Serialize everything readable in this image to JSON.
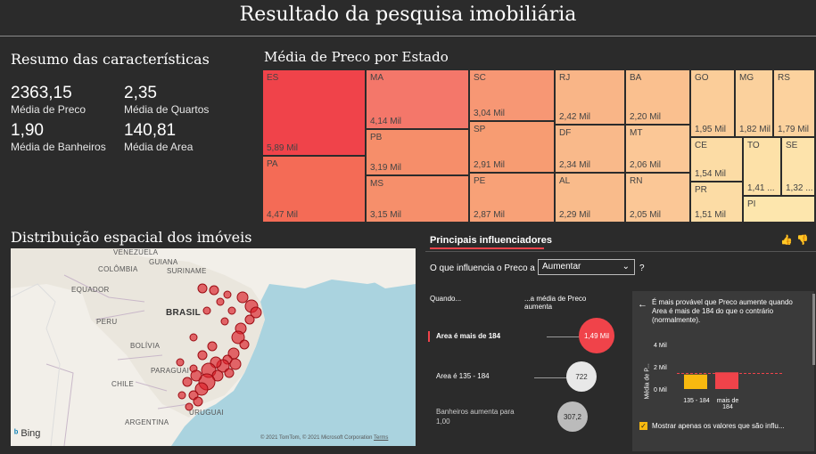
{
  "header": {
    "title": "Resultado da pesquisa imobiliária"
  },
  "summary": {
    "title": "Resumo das características",
    "kpis": [
      {
        "value": "2363,15",
        "label": "Média de Preco"
      },
      {
        "value": "2,35",
        "label": "Média de Quartos"
      },
      {
        "value": "1,90",
        "label": "Média de Banheiros"
      },
      {
        "value": "140,81",
        "label": "Média de Area"
      }
    ]
  },
  "treemap": {
    "title": "Média de Preco por Estado",
    "cells": [
      {
        "state": "ES",
        "value": "5,89 Mil",
        "color": "#f0434a"
      },
      {
        "state": "PA",
        "value": "4,47 Mil",
        "color": "#f46b56"
      },
      {
        "state": "MA",
        "value": "4,14 Mil",
        "color": "#f4776a"
      },
      {
        "state": "PB",
        "value": "3,19 Mil",
        "color": "#f68e6a"
      },
      {
        "state": "MS",
        "value": "3,15 Mil",
        "color": "#f68f6b"
      },
      {
        "state": "SC",
        "value": "3,04 Mil",
        "color": "#f79774"
      },
      {
        "state": "SP",
        "value": "2,91 Mil",
        "color": "#f79c72"
      },
      {
        "state": "PE",
        "value": "2,87 Mil",
        "color": "#f8a177"
      },
      {
        "state": "RJ",
        "value": "2,42 Mil",
        "color": "#f9b587"
      },
      {
        "state": "DF",
        "value": "2,34 Mil",
        "color": "#f9b98a"
      },
      {
        "state": "AL",
        "value": "2,29 Mil",
        "color": "#f9bb8b"
      },
      {
        "state": "BA",
        "value": "2,20 Mil",
        "color": "#fac08f"
      },
      {
        "state": "MT",
        "value": "2,06 Mil",
        "color": "#fbc796"
      },
      {
        "state": "RN",
        "value": "2,05 Mil",
        "color": "#fbc796"
      },
      {
        "state": "GO",
        "value": "1,95 Mil",
        "color": "#fbcd99"
      },
      {
        "state": "MG",
        "value": "1,82 Mil",
        "color": "#fbd19d"
      },
      {
        "state": "RS",
        "value": "1,79 Mil",
        "color": "#fcd29e"
      },
      {
        "state": "CE",
        "value": "1,54 Mil",
        "color": "#fcdca5"
      },
      {
        "state": "TO",
        "value": "1,41 ...",
        "color": "#fde1a8"
      },
      {
        "state": "SE",
        "value": "1,32 ...",
        "color": "#fde3ab"
      },
      {
        "state": "PR",
        "value": "1,51 Mil",
        "color": "#fcdca5"
      },
      {
        "state": "PI",
        "value": "",
        "color": "#fde6ad"
      }
    ]
  },
  "map": {
    "title": "Distribuição espacial dos imóveis",
    "labels": [
      "VENEZUELA",
      "GUIANA",
      "COLÔMBIA",
      "SURINAME",
      "EQUADOR",
      "PERU",
      "BRASIL",
      "BOLÍVIA",
      "PARAGUAI",
      "CHILE",
      "ARGENTINA",
      "URUGUAI"
    ],
    "bing": "Bing",
    "attribution": "© 2021 TomTom, © 2021 Microsoft Corporation",
    "terms": "Terms"
  },
  "influencers": {
    "tab": "Principais influenciadores",
    "question_prefix": "O que influencia o Preco a",
    "dropdown": "Aumentar",
    "question_suffix": "?",
    "col_when": "Quando...",
    "col_avg": "...a média de Preco aumenta",
    "rows": [
      {
        "label": "Area é mais de 184",
        "value": "1,49 Mil"
      },
      {
        "label": "Area é 135 - 184",
        "value": "722"
      },
      {
        "label": "Banheiros aumenta para",
        "sub": "1,00",
        "value": "307,2"
      }
    ],
    "detail": {
      "back": "←",
      "text": "É mais provável que Preco aumente quando Area é mais de 184 do que o contrário (normalmente).",
      "ylabel": "Média de P...",
      "yticks": [
        "4 Mil",
        "2 Mil",
        "0 Mil"
      ],
      "bars": [
        {
          "label": "135 - 184",
          "value": 1.3,
          "color": "#f8b90f"
        },
        {
          "label": "mais de 184",
          "value": 1.5,
          "color": "#f0434a"
        }
      ],
      "checkbox": "Mostrar apenas os valores que são influ..."
    }
  }
}
